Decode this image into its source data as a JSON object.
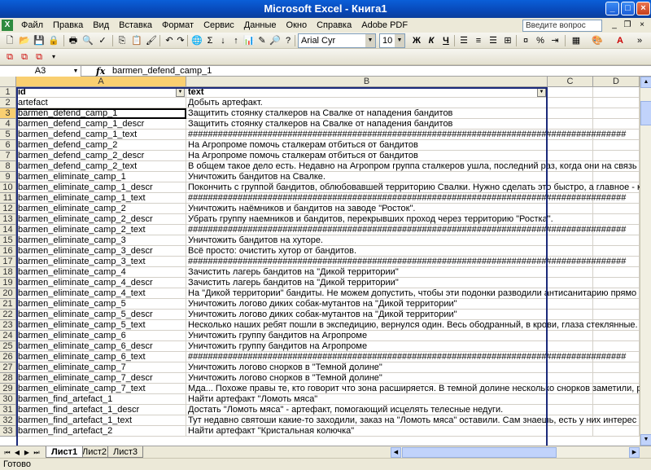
{
  "window": {
    "title": "Microsoft Excel - Книга1"
  },
  "menu": {
    "items": [
      "Файл",
      "Правка",
      "Вид",
      "Вставка",
      "Формат",
      "Сервис",
      "Данные",
      "Окно",
      "Справка",
      "Adobe PDF"
    ],
    "help_placeholder": "Введите вопрос"
  },
  "toolbar": {
    "font_name": "Arial Cyr",
    "font_size": "10",
    "bold_label": "Ж",
    "italic_label": "К",
    "underline_label": "Ч"
  },
  "formula_bar": {
    "name_box": "A3",
    "fx_label": "fx",
    "content": "barmen_defend_camp_1"
  },
  "columns": [
    "A",
    "B",
    "C",
    "D"
  ],
  "rows": [
    {
      "num": "1",
      "a": "id",
      "b": "text"
    },
    {
      "num": "2",
      "a": "artefact",
      "b": "Добыть артефакт."
    },
    {
      "num": "3",
      "a": "barmen_defend_camp_1",
      "b": "Защитить стоянку сталкеров на Свалке от нападения бандитов"
    },
    {
      "num": "4",
      "a": "barmen_defend_camp_1_descr",
      "b": "Защитить стоянку сталкеров на Свалке от нападения бандитов"
    },
    {
      "num": "5",
      "a": "barmen_defend_camp_1_text",
      "b": "########################################################################################"
    },
    {
      "num": "6",
      "a": "barmen_defend_camp_2",
      "b": "На Агропроме помочь сталкерам отбиться от бандитов"
    },
    {
      "num": "7",
      "a": "barmen_defend_camp_2_descr",
      "b": "На Агропроме помочь сталкерам отбиться от бандитов"
    },
    {
      "num": "8",
      "a": "barmen_defend_camp_2_text",
      "b": "В общем такое дело есть. Недавно на Агропром группа сталкеров ушла, последний раз, когда они на связь выходил"
    },
    {
      "num": "9",
      "a": "barmen_eliminate_camp_1",
      "b": "Уничтожить бандитов на Свалке."
    },
    {
      "num": "10",
      "a": "barmen_eliminate_camp_1_descr",
      "b": "Покончить с группой бандитов, облюбовавшей территорию Свалки. Нужно сделать это быстро, а главное - качественн"
    },
    {
      "num": "11",
      "a": "barmen_eliminate_camp_1_text",
      "b": "########################################################################################"
    },
    {
      "num": "12",
      "a": "barmen_eliminate_camp_2",
      "b": "Уничтожить наёмников и бандитов на заводе \"Росток\"."
    },
    {
      "num": "13",
      "a": "barmen_eliminate_camp_2_descr",
      "b": "Убрать группу наемников и бандитов, перекрывших проход через территорию \"Ростка\"."
    },
    {
      "num": "14",
      "a": "barmen_eliminate_camp_2_text",
      "b": "########################################################################################"
    },
    {
      "num": "15",
      "a": "barmen_eliminate_camp_3",
      "b": "Уничтожить бандитов на хуторе."
    },
    {
      "num": "16",
      "a": "barmen_eliminate_camp_3_descr",
      "b": "Всё просто: очистить хутор от бандитов."
    },
    {
      "num": "17",
      "a": "barmen_eliminate_camp_3_text",
      "b": "########################################################################################"
    },
    {
      "num": "18",
      "a": "barmen_eliminate_camp_4",
      "b": "Зачистить лагерь бандитов на \"Дикой территории\""
    },
    {
      "num": "19",
      "a": "barmen_eliminate_camp_4_descr",
      "b": "Зачистить лагерь бандитов на \"Дикой территории\""
    },
    {
      "num": "20",
      "a": "barmen_eliminate_camp_4_text",
      "b": "На \"Дикой территории\" бандиты. Не можем допустить, чтобы эти подонки разводили антисанитарию прямо рядом"
    },
    {
      "num": "21",
      "a": "barmen_eliminate_camp_5",
      "b": "Уничтожить логово диких собак-мутантов на \"Дикой территории\""
    },
    {
      "num": "22",
      "a": "barmen_eliminate_camp_5_descr",
      "b": "Уничтожить логово диких собак-мутантов на \"Дикой территории\""
    },
    {
      "num": "23",
      "a": "barmen_eliminate_camp_5_text",
      "b": "Несколько наших ребят пошли в экспедицию, вернулся один. Весь ободранный, в крови, глаза стеклянные. Нарвали"
    },
    {
      "num": "24",
      "a": "barmen_eliminate_camp_6",
      "b": "Уничтожить группу бандитов на Агропроме"
    },
    {
      "num": "25",
      "a": "barmen_eliminate_camp_6_descr",
      "b": "Уничтожить группу бандитов на Агропроме"
    },
    {
      "num": "26",
      "a": "barmen_eliminate_camp_6_text",
      "b": "########################################################################################"
    },
    {
      "num": "27",
      "a": "barmen_eliminate_camp_7",
      "b": "Уничтожить логово снорков в \"Темной долине\""
    },
    {
      "num": "28",
      "a": "barmen_eliminate_camp_7_descr",
      "b": "Уничтожить логово снорков в \"Темной долине\""
    },
    {
      "num": "29",
      "a": "barmen_eliminate_camp_7_text",
      "b": "Мда... Похоже правы те, кто говорит что зона расширяется. В темной долине несколько снорков заметили, раньше о"
    },
    {
      "num": "30",
      "a": "barmen_find_artefact_1",
      "b": "Найти артефакт \"Ломоть мяса\""
    },
    {
      "num": "31",
      "a": "barmen_find_artefact_1_descr",
      "b": "Достать \"Ломоть мяса\" - артефакт, помогающий исцелять телесные недуги."
    },
    {
      "num": "32",
      "a": "barmen_find_artefact_1_text",
      "b": "Тут недавно святоши какие-то заходили, заказ на \"Ломоть мяса\" оставили. Сам знаешь, есть у них интерес к этому а"
    },
    {
      "num": "33",
      "a": "barmen_find_artefact_2",
      "b": "Найти артефакт \"Кристальная колючка\""
    }
  ],
  "sheet_tabs": [
    "Лист1",
    "Лист2",
    "Лист3"
  ],
  "status": "Готово"
}
